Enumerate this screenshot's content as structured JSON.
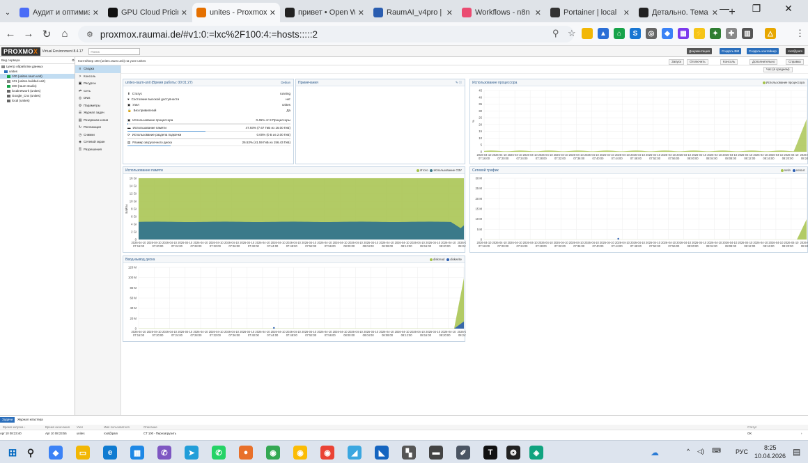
{
  "browser": {
    "tabs": [
      {
        "label": "Аудит и оптимиз",
        "icon": "spark-icon",
        "color": "#4a6cf7",
        "active": false
      },
      {
        "label": "GPU Cloud Pricin",
        "icon": "cloud-icon",
        "color": "#111111",
        "active": false
      },
      {
        "label": "unites - Proxmox",
        "icon": "proxmox-icon",
        "color": "#e57000",
        "active": true
      },
      {
        "label": "привет • Open W",
        "icon": "openwebui-icon",
        "color": "#222222",
        "active": false
      },
      {
        "label": "RaumAI_v4pro | ",
        "icon": "notion-icon",
        "color": "#2a5db0",
        "active": false
      },
      {
        "label": "Workflows - n8n",
        "icon": "n8n-icon",
        "color": "#ea4b71",
        "active": false
      },
      {
        "label": "Portainer | local",
        "icon": "portainer-icon",
        "color": "#333333",
        "active": false
      },
      {
        "label": "Детально. Тема",
        "icon": "openwebui-icon",
        "color": "#222222",
        "active": false
      }
    ],
    "url": "proxmox.raumai.de/#v1:0:=lxc%2F100:4:=hosts:::::2"
  },
  "pve": {
    "logo_a": "PROXMO",
    "logo_b": "X",
    "version": "Virtual Environment 8.4.17",
    "search_placeholder": "Поиск",
    "header_buttons": [
      "Документация",
      "Создать ВМ",
      "Создать контейнер",
      "root@pam"
    ],
    "view": "Вид сервера",
    "tree": [
      {
        "label": "Центр обработки данных",
        "indent": 0,
        "selected": false
      },
      {
        "label": "unites",
        "indent": 1,
        "selected": false
      },
      {
        "label": "100 (unites.raum.unit)",
        "indent": 2,
        "selected": true
      },
      {
        "label": "101 (unites.builded.unit)",
        "indent": 2,
        "selected": false
      },
      {
        "label": "300 (raum-studio)",
        "indent": 2,
        "selected": false
      },
      {
        "label": "localnetwork (unites)",
        "indent": 2,
        "selected": false
      },
      {
        "label": "Google_Cnx (unites)",
        "indent": 2,
        "selected": false
      },
      {
        "label": "local (unites)",
        "indent": 2,
        "selected": false
      }
    ],
    "context_title": "Контейнер 100 (unites.raum.unit) на узле unites",
    "actions": [
      "Запуск",
      "Отключить",
      "Консоль",
      "Дополнительно",
      "Справка"
    ],
    "timeframe": "Час (в среднем)",
    "menu": [
      {
        "label": "Сводка",
        "icon": "≡",
        "selected": true
      },
      {
        "label": "Консоль",
        "icon": ">",
        "selected": false
      },
      {
        "label": "Ресурсы",
        "icon": "▣",
        "selected": false
      },
      {
        "label": "Сеть",
        "icon": "⇄",
        "selected": false
      },
      {
        "label": "DNS",
        "icon": "◎",
        "selected": false
      },
      {
        "label": "Параметры",
        "icon": "⚙",
        "selected": false
      },
      {
        "label": "Журнал задач",
        "icon": "☰",
        "selected": false
      },
      {
        "label": "Резервная копия",
        "icon": "▤",
        "selected": false
      },
      {
        "label": "Репликация",
        "icon": "↻",
        "selected": false
      },
      {
        "label": "Снимки",
        "icon": "◷",
        "selected": false
      },
      {
        "label": "Сетевой экран",
        "icon": "◈",
        "selected": false
      },
      {
        "label": "Разрешения",
        "icon": "⚿",
        "selected": false
      }
    ],
    "status": {
      "title": "unites-raum-unit (Время работы: 00:01:27)",
      "os": "Debian",
      "rows": [
        {
          "label": "Статус",
          "value": "running"
        },
        {
          "label": "Состояние высокой доступности",
          "value": "нет"
        },
        {
          "label": "Узел",
          "value": "unites"
        },
        {
          "label": "Без привилегий",
          "value": "Да"
        }
      ],
      "resources": [
        {
          "label": "Использование процессора",
          "value": "0.45% от 8 Процессоры",
          "pct": 0.0045
        },
        {
          "label": "Использование памяти",
          "value": "47.93% (7.67 ГиБ из 16.00 ГиБ)",
          "pct": 0.4793
        },
        {
          "label": "Использование раздела подкачки",
          "value": "0.00% (0 Б из 2.00 ГиБ)",
          "pct": 0.0
        },
        {
          "label": "Размер загрузочного диска",
          "value": "26.53% (41.59 ГиБ из 156.43 ГиБ)",
          "pct": 0.2653
        }
      ]
    },
    "notes_title": "Примечания",
    "cpu_chart": {
      "title": "Использование процессора",
      "legend": "Использование процессора",
      "ylabel": "%",
      "yticks": [
        "45",
        "40",
        "35",
        "30",
        "25",
        "20",
        "15",
        "10",
        "5",
        "0"
      ],
      "color": "#a5c24a"
    },
    "mem_chart": {
      "title": "Использование памяти",
      "legend": [
        "Итого",
        "Использование ОЗУ"
      ],
      "ylabel": "Байты",
      "yticks": [
        "16 Gi",
        "14 Gi",
        "12 Gi",
        "10 Gi",
        "8 Gi",
        "6 Gi",
        "4 Gi",
        "2 Gi",
        "0"
      ],
      "colors": [
        "#a5c24a",
        "#3b7a8a"
      ]
    },
    "net_chart": {
      "title": "Сетевой трафик",
      "legend": [
        "netin",
        "netout"
      ],
      "yticks": [
        "30 M",
        "25 M",
        "20 M",
        "15 M",
        "10 M",
        "5 M",
        "0"
      ],
      "colors": [
        "#a5c24a",
        "#2a5db0"
      ]
    },
    "disk_chart": {
      "title": "Ввод-вывод диска",
      "legend": [
        "diskread",
        "diskwrite"
      ],
      "yticks": [
        "120 M",
        "100 M",
        "80 M",
        "60 M",
        "40 M",
        "20 M",
        "0"
      ],
      "colors": [
        "#a5c24a",
        "#2a5db0"
      ]
    },
    "xdates": [
      "2026-04-10",
      "2026-04-10",
      "2026-04-10",
      "2026-04-10",
      "2026-04-10",
      "2026-04-10",
      "2026-04-10",
      "2026-04-10",
      "2026-04-10",
      "2026-04-10",
      "2026-04-10",
      "2026-04-10",
      "2026-04-10",
      "2026-04-10",
      "2026-04-10",
      "2026-04-10",
      "2026-04-10",
      "2026-04-10",
      "2026-04-10",
      "2026-04-10",
      "2026-04-10",
      "2026-04-1"
    ],
    "xtimes": [
      "07:16:00",
      "07:20:00",
      "07:24:00",
      "07:28:00",
      "07:32:00",
      "07:36:00",
      "07:40:00",
      "07:44:00",
      "07:48:00",
      "07:52:00",
      "07:56:00",
      "08:00:00",
      "08:04:00",
      "08:08:00",
      "08:12:00",
      "08:16:00",
      "08:20:00",
      "08:24:00"
    ],
    "bottom": {
      "tabs": [
        "Задачи",
        "Журнал кластера"
      ],
      "headers": [
        "Время запуска ↓",
        "Время окончания",
        "Узел",
        "Имя пользователя",
        "Описание",
        "Статус"
      ],
      "row": [
        "Apr 10 08:23:40",
        "Apr 10 08:23:55",
        "unites",
        "root@pam",
        "CT 100 - Перезагрузить",
        "OK"
      ]
    }
  },
  "taskbar": {
    "lang": "РУС",
    "time": "8:25",
    "date": "10.04.2026"
  }
}
